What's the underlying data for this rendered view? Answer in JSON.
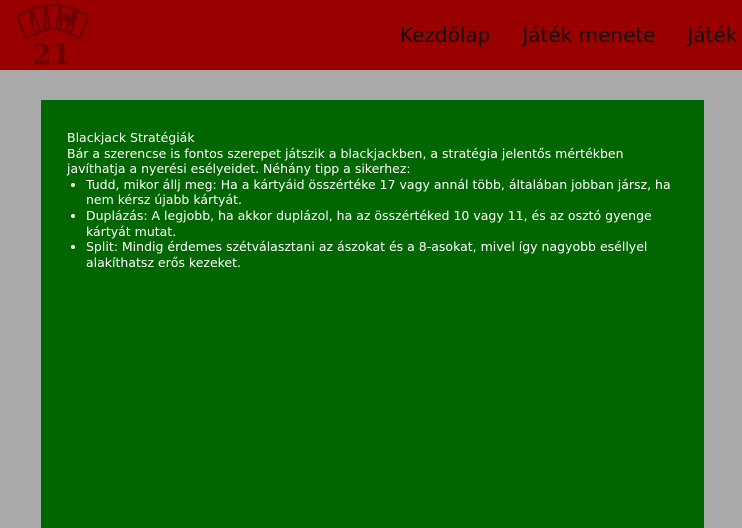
{
  "header": {
    "logo": {
      "icon": "cards-21-logo-icon",
      "text": "21",
      "color": "#7a0000"
    },
    "nav": [
      {
        "label": "Kezdőlap"
      },
      {
        "label": "Játék menete"
      },
      {
        "label": "Játék"
      }
    ],
    "background": "#990000"
  },
  "main": {
    "title": "Blackjack Stratégiák",
    "intro": "Bár a szerencse is fontos szerepet játszik a blackjackben, a stratégia jelentős mértékben javíthatja a nyerési esélyeidet. Néhány tipp a sikerhez:",
    "tips": [
      {
        "text": "Tudd, mikor állj meg: Ha a kártyáid összértéke 17 vagy annál több, általában jobban jársz, ha nem kérsz újabb kártyát."
      },
      {
        "text": "Duplázás: A legjobb, ha akkor duplázol, ha az összértéked 10 vagy 11, és az osztó gyenge kártyát mutat."
      },
      {
        "text": "Split: Mindig érdemes szétválasztani az ászokat és a 8-asokat, mivel így nagyobb eséllyel alakíthatsz erős kezeket."
      }
    ],
    "background": "#006600"
  },
  "page": {
    "background": "#a9a9a9"
  }
}
